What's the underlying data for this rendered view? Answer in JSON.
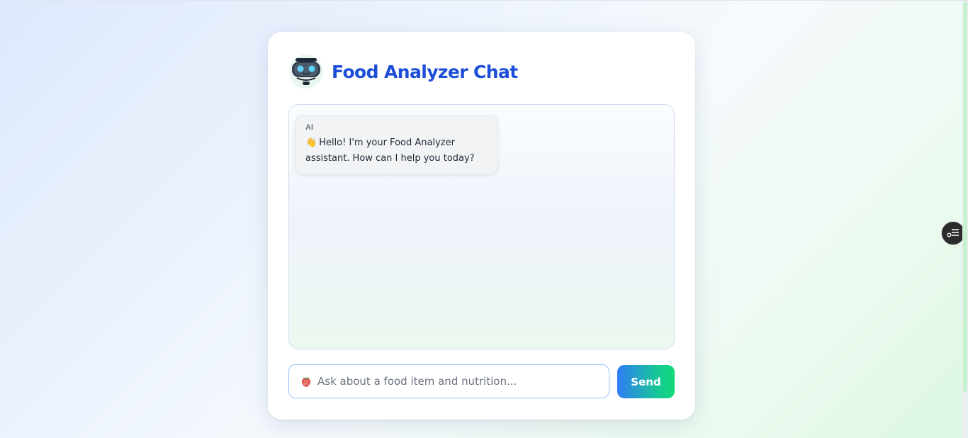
{
  "header": {
    "title": "Food Analyzer Chat",
    "icon": "robot-icon"
  },
  "messages": [
    {
      "sender": "AI",
      "emoji": "👋",
      "text": "Hello! I'm your Food Analyzer assistant. How can I help you today?"
    }
  ],
  "composer": {
    "prefix_icon": "strawberry-icon",
    "placeholder": "Ask about a food item and nutrition...",
    "value": "",
    "send_label": "Send"
  },
  "side_widget": {
    "icon": "settings-list-icon"
  },
  "colors": {
    "title": "#1d4ed8",
    "send_gradient_start": "#2f7cf6",
    "send_gradient_end": "#10d97a",
    "input_border": "#93c5fd"
  }
}
